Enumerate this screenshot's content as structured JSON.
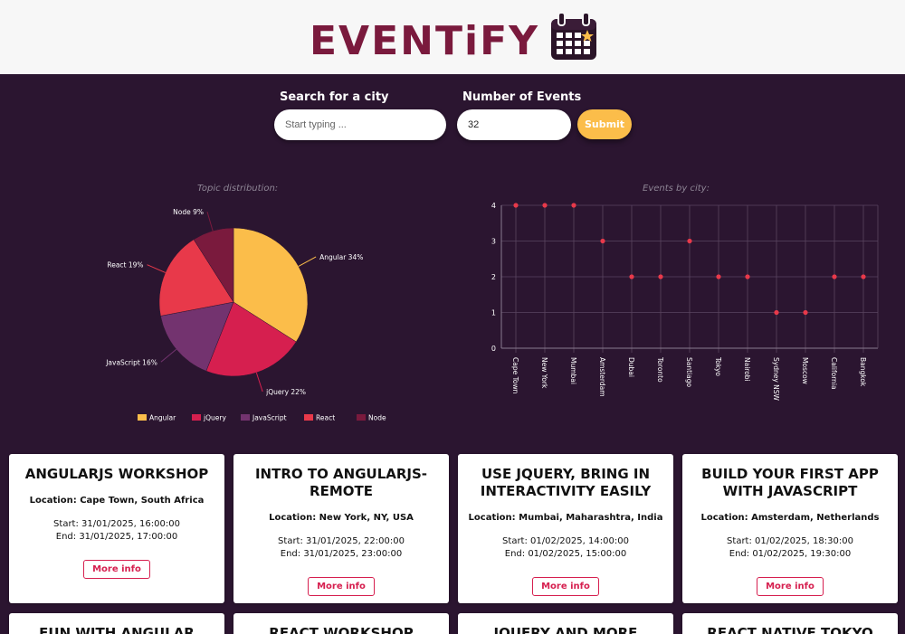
{
  "header": {
    "logo_text": "EVENTiFY",
    "logo_icon": "calendar-star-icon"
  },
  "search": {
    "city_label": "Search for a city",
    "city_placeholder": "Start typing ...",
    "city_value": "",
    "number_label": "Number of Events",
    "number_value": "32",
    "submit_label": "Submit"
  },
  "colors": {
    "background": "#2b1530",
    "brand": "#7a1a3d",
    "accent": "#fbbd4a",
    "button_border": "#d61f4f"
  },
  "chart_data": [
    {
      "type": "pie",
      "title": "Topic distribution:",
      "categories": [
        "Angular",
        "jQuery",
        "JavaScript",
        "React",
        "Node"
      ],
      "values": [
        34,
        22,
        16,
        19,
        9
      ],
      "labels": [
        "Angular 34%",
        "jQuery 22%",
        "JavaScript 16%",
        "React 19%",
        "Node 9%"
      ],
      "colors": [
        "#fbbd4a",
        "#d61f4f",
        "#73336f",
        "#e8394a",
        "#7a1a3d"
      ],
      "legend": "bottom"
    },
    {
      "type": "scatter",
      "title": "Events by city:",
      "categories": [
        "Cape Town",
        "New York",
        "Mumbai",
        "Amsterdam",
        "Dubai",
        "Toronto",
        "Santiago",
        "Tokyo",
        "Nairobi",
        "Sydney NSW",
        "Moscow",
        "California",
        "Bangkok"
      ],
      "values": [
        4,
        4,
        4,
        3,
        2,
        2,
        3,
        2,
        2,
        1,
        1,
        2,
        2
      ],
      "ylim": [
        0,
        4
      ],
      "yticks": [
        "0",
        "1",
        "2",
        "3",
        "4"
      ],
      "grid": true,
      "color": "#e8394a"
    }
  ],
  "events": [
    {
      "title": "ANGULARJS WORKSHOP",
      "location": "Location: Cape Town, South Africa",
      "start": "Start: 31/01/2025, 16:00:00",
      "end": "End: 31/01/2025, 17:00:00",
      "button": "More info"
    },
    {
      "title": "INTRO TO ANGULARJS-REMOTE",
      "location": "Location: New York, NY, USA",
      "start": "Start: 31/01/2025, 22:00:00",
      "end": "End: 31/01/2025, 23:00:00",
      "button": "More info"
    },
    {
      "title": "USE JQUERY, BRING IN INTERACTIVITY EASILY",
      "location": "Location: Mumbai, Maharashtra, India",
      "start": "Start: 01/02/2025, 14:00:00",
      "end": "End: 01/02/2025, 15:00:00",
      "button": "More info"
    },
    {
      "title": "BUILD YOUR FIRST APP WITH JAVASCRIPT",
      "location": "Location: Amsterdam, Netherlands",
      "start": "Start: 01/02/2025, 18:30:00",
      "end": "End: 01/02/2025, 19:30:00",
      "button": "More info"
    },
    {
      "title": "FUN WITH ANGULAR"
    },
    {
      "title": "REACT WORKSHOP"
    },
    {
      "title": "JQUERY AND MORE"
    },
    {
      "title": "REACT NATIVE TOKYO"
    }
  ]
}
